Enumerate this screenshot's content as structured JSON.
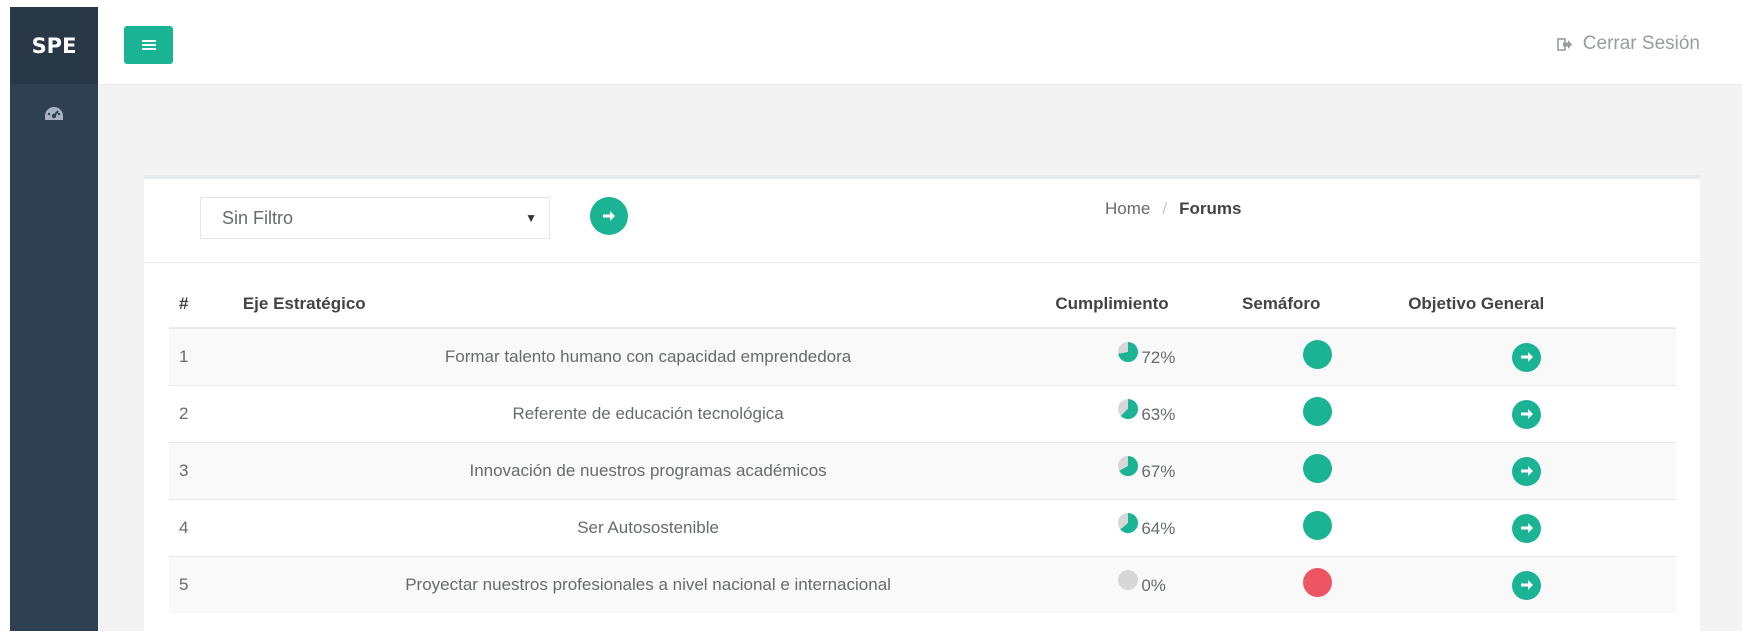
{
  "brand": "SPE",
  "nav": [
    {
      "icon": "dashboard-icon"
    }
  ],
  "topbar": {
    "menu_icon": "bars-icon",
    "logout_label": "Cerrar Sesión",
    "logout_icon": "sign-out-icon"
  },
  "filter": {
    "selected": "Sin Filtro"
  },
  "breadcrumb": {
    "home": "Home",
    "separator": "/",
    "current": "Forums"
  },
  "table": {
    "headers": [
      "#",
      "Eje Estratégico",
      "Cumplimiento",
      "Semáforo",
      "Objetivo General"
    ],
    "rows": [
      {
        "num": "1",
        "eje": "Formar talento humano con capacidad emprendedora",
        "pct": "72%",
        "pct_value": 72,
        "status": "green"
      },
      {
        "num": "2",
        "eje": "Referente de educación tecnológica",
        "pct": "63%",
        "pct_value": 63,
        "status": "green"
      },
      {
        "num": "3",
        "eje": "Innovación de nuestros programas académicos",
        "pct": "67%",
        "pct_value": 67,
        "status": "green"
      },
      {
        "num": "4",
        "eje": "Ser Autosostenible",
        "pct": "64%",
        "pct_value": 64,
        "status": "green"
      },
      {
        "num": "5",
        "eje": "Proyectar nuestros profesionales a nivel nacional e internacional",
        "pct": "0%",
        "pct_value": 0,
        "status": "red"
      }
    ]
  },
  "colors": {
    "accent": "#1ab394",
    "green": "#1ab394",
    "red": "#ed5565",
    "sidebar": "#2f4050",
    "pie_bg": "#d7d7d7"
  }
}
